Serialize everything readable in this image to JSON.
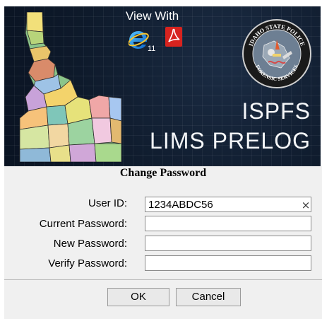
{
  "banner": {
    "view_with": "View With",
    "ie_version": "11",
    "product_line1": "ISPFS",
    "product_line2": "LIMS PRELOG",
    "badge_text_top": "IDAHO STATE POLICE",
    "badge_text_bottom": "FORENSIC SERVICES",
    "icons": {
      "browser": "internet-explorer-icon",
      "pdf": "adobe-pdf-icon",
      "logo": "isp-forensic-badge"
    }
  },
  "form": {
    "title": "Change Password",
    "fields": [
      {
        "label": "User ID:",
        "value": "1234ABDC56"
      },
      {
        "label": "Current Password:",
        "value": ""
      },
      {
        "label": "New Password:",
        "value": ""
      },
      {
        "label": "Verify Password:",
        "value": ""
      }
    ],
    "clear_glyph": "×",
    "buttons": {
      "ok": "OK",
      "cancel": "Cancel"
    }
  },
  "colors": {
    "banner_bg": "#0e1a2b",
    "panel_bg": "#f0f0f0",
    "button_bg": "#e9e9e9"
  }
}
